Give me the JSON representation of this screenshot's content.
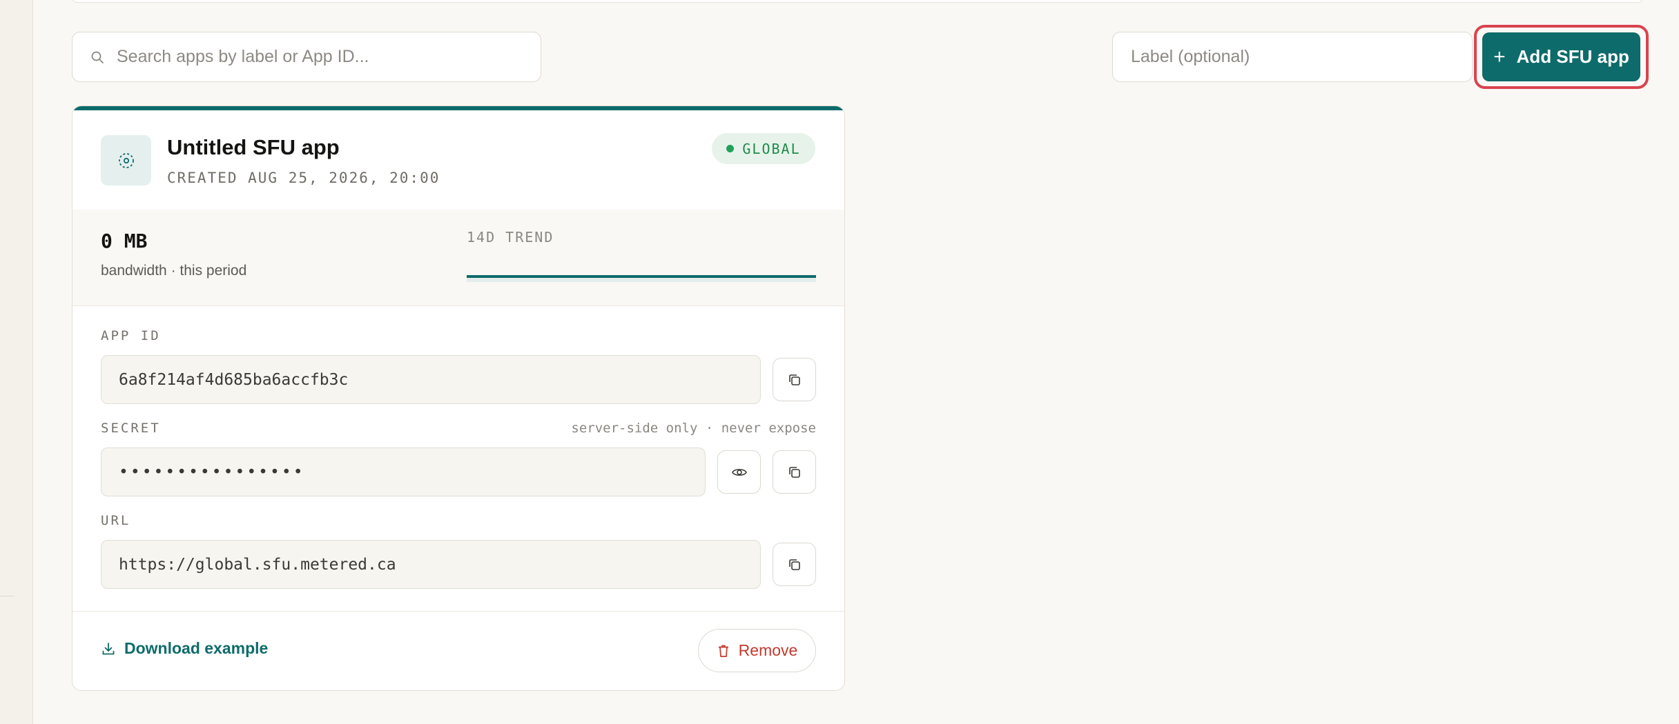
{
  "toolbar": {
    "search_placeholder": "Search apps by label or App ID...",
    "label_placeholder": "Label (optional)",
    "add_button_label": "Add SFU app"
  },
  "app_card": {
    "title": "Untitled SFU app",
    "created": "CREATED AUG 25, 2026, 20:00",
    "region_badge": "GLOBAL",
    "usage_value": "0 MB",
    "usage_caption": "bandwidth · this period",
    "trend_label": "14D TREND",
    "app_id_label": "APP ID",
    "app_id_value": "6a8f214af4d685ba6accfb3c",
    "secret_label": "SECRET",
    "secret_hint": "server-side only · never expose",
    "secret_value": "••••••••••••••••",
    "url_label": "URL",
    "url_value": "https://global.sfu.metered.ca",
    "download_label": "Download example",
    "remove_label": "Remove"
  },
  "colors": {
    "accent": "#0e6b6b",
    "badge_green": "#1f8a4a",
    "danger": "#c23a2e",
    "focus_ring": "#d9434f"
  }
}
